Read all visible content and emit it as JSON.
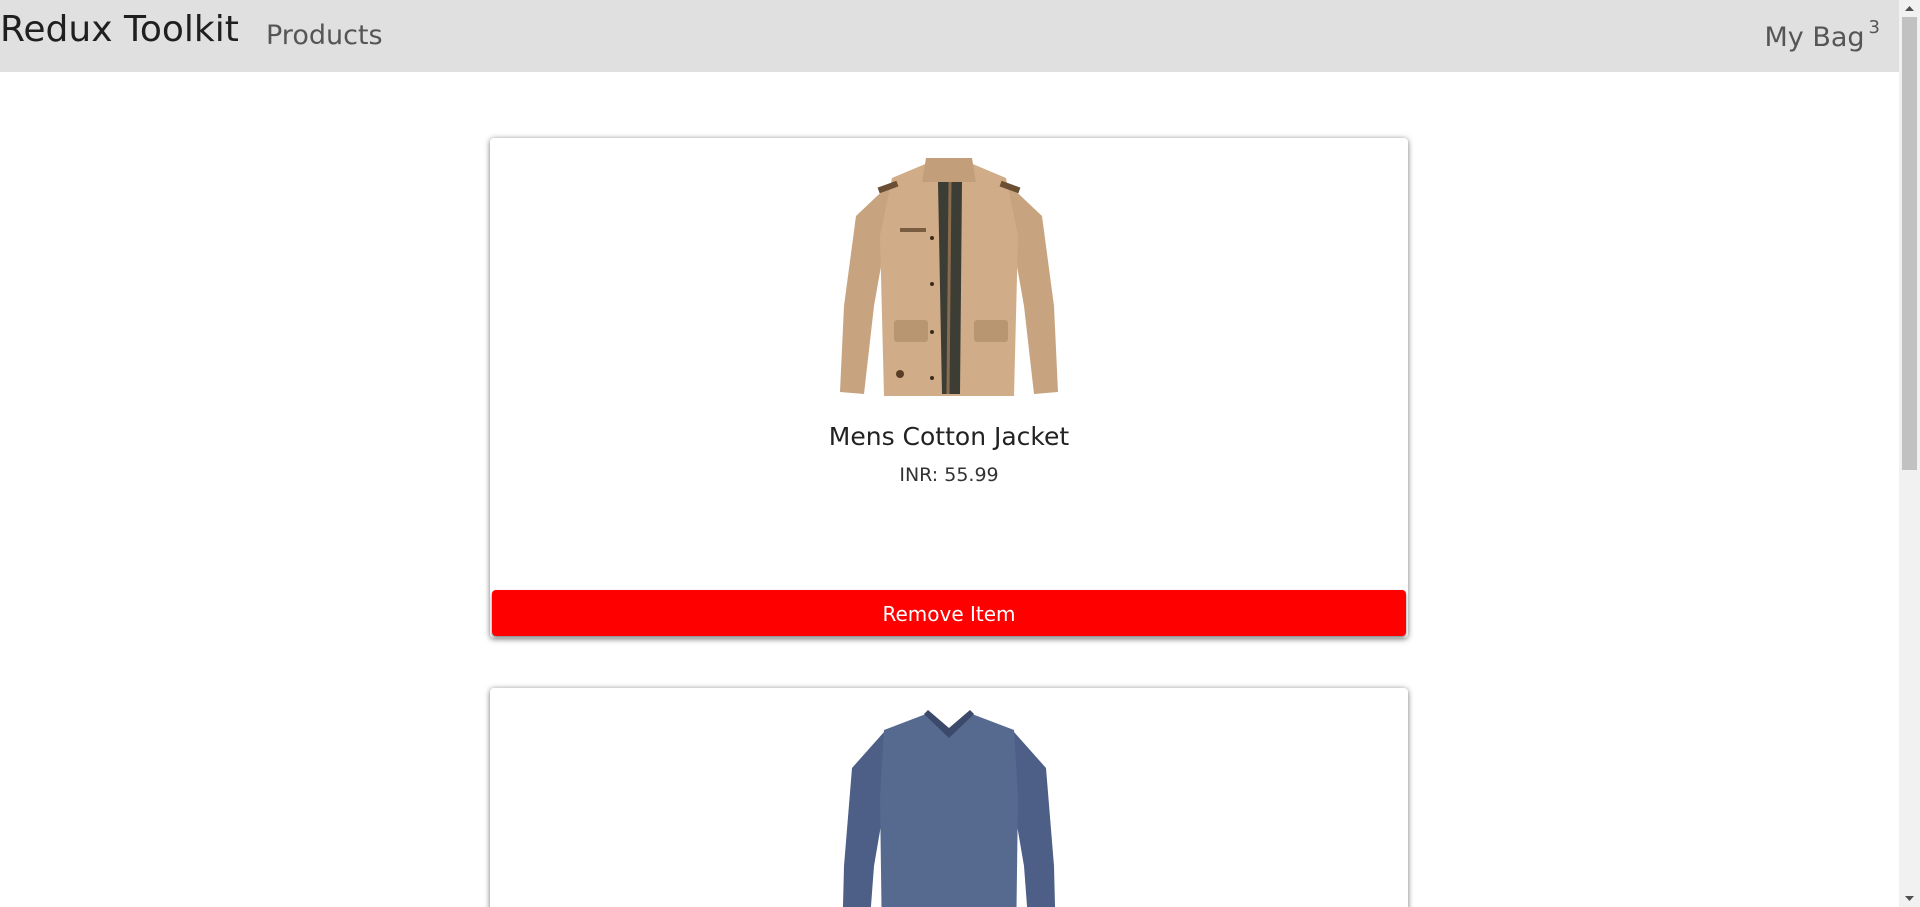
{
  "navbar": {
    "brand": "Redux Toolkit",
    "products_link": "Products",
    "bag_label": "My Bag",
    "bag_count": "3"
  },
  "products": [
    {
      "title": "Mens Cotton Jacket",
      "price": "INR: 55.99",
      "remove_label": "Remove Item",
      "image_icon": "jacket-image"
    },
    {
      "image_icon": "tshirt-image"
    }
  ],
  "colors": {
    "navbar_bg": "#e0e0e0",
    "remove_button": "#ff0000"
  }
}
